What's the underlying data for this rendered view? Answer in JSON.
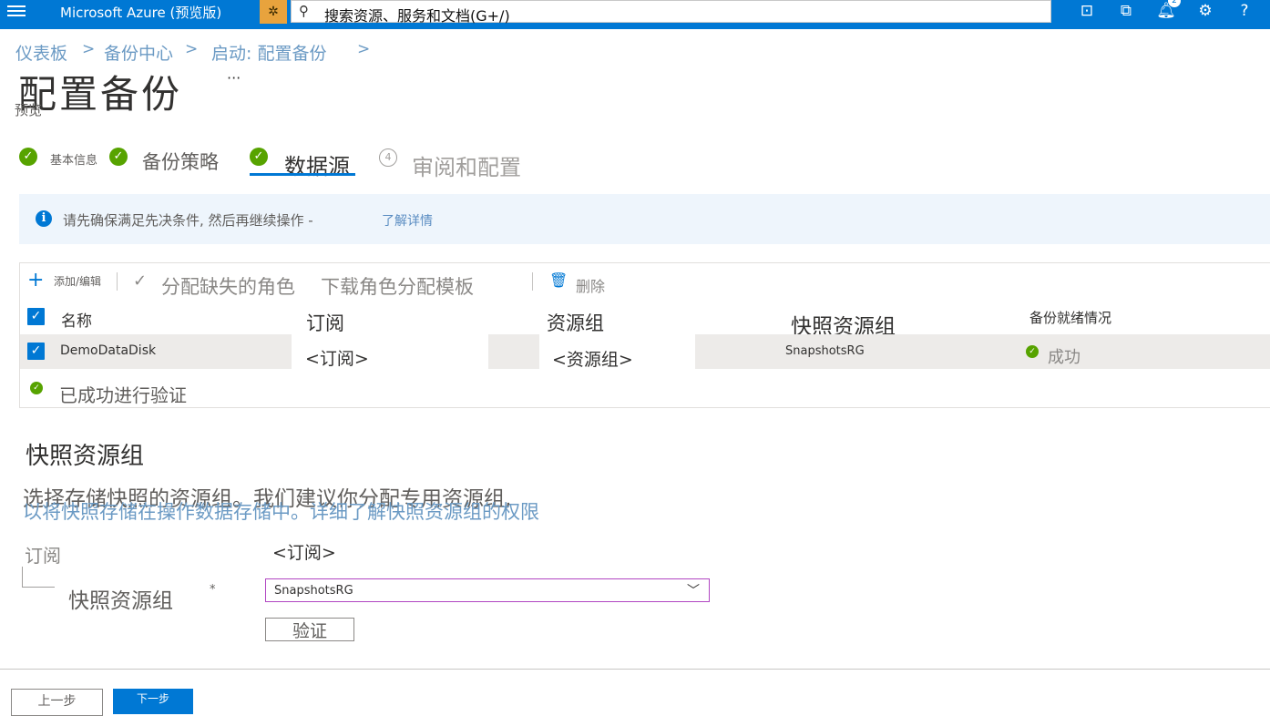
{
  "topbar": {
    "brand": "Microsoft Azure (预览版)",
    "search_placeholder": "搜索资源、服务和文档(G+/)",
    "notification_count": "2"
  },
  "breadcrumb": {
    "items": [
      "仪表板",
      "备份中心",
      "启动: 配置备份"
    ],
    "separator": ">"
  },
  "page": {
    "title": "配置备份",
    "more": "···",
    "subtitle": "预览"
  },
  "steps": [
    {
      "label": "基本信息",
      "state": "done"
    },
    {
      "label": "备份策略",
      "state": "done"
    },
    {
      "label": "数据源",
      "state": "active"
    },
    {
      "label": "审阅和配置",
      "state": "pending",
      "number": "4"
    }
  ],
  "info": {
    "text": "请先确保满足先决条件, 然后再继续操作 -",
    "link": "了解详情"
  },
  "toolbar": {
    "add_edit": "添加/编辑",
    "assign_roles": "分配缺失的角色",
    "download_template": "下载角色分配模板",
    "delete": "删除"
  },
  "table": {
    "headers": [
      "名称",
      "订阅",
      "资源组",
      "快照资源组",
      "备份就绪情况"
    ],
    "rows": [
      {
        "name": "DemoDataDisk",
        "subscription": "<订阅>",
        "resource_group": "<资源组>",
        "snapshot_rg": "SnapshotsRG",
        "readiness": "成功"
      }
    ],
    "validation_message": "已成功进行验证"
  },
  "snapshot_section": {
    "title": "快照资源组",
    "desc_line1": "选择存储快照的资源组。我们建议你分配专用资源组,",
    "desc_line2": "以将快照存储在操作数据存储中。详细了解快照资源组的权限",
    "subscription_label": "订阅",
    "subscription_value": "<订阅>",
    "rg_label": "快照资源组",
    "required_mark": "*",
    "rg_selected": "SnapshotsRG",
    "validate_button": "验证"
  },
  "footer": {
    "prev": "上一步",
    "next": "下一步"
  }
}
